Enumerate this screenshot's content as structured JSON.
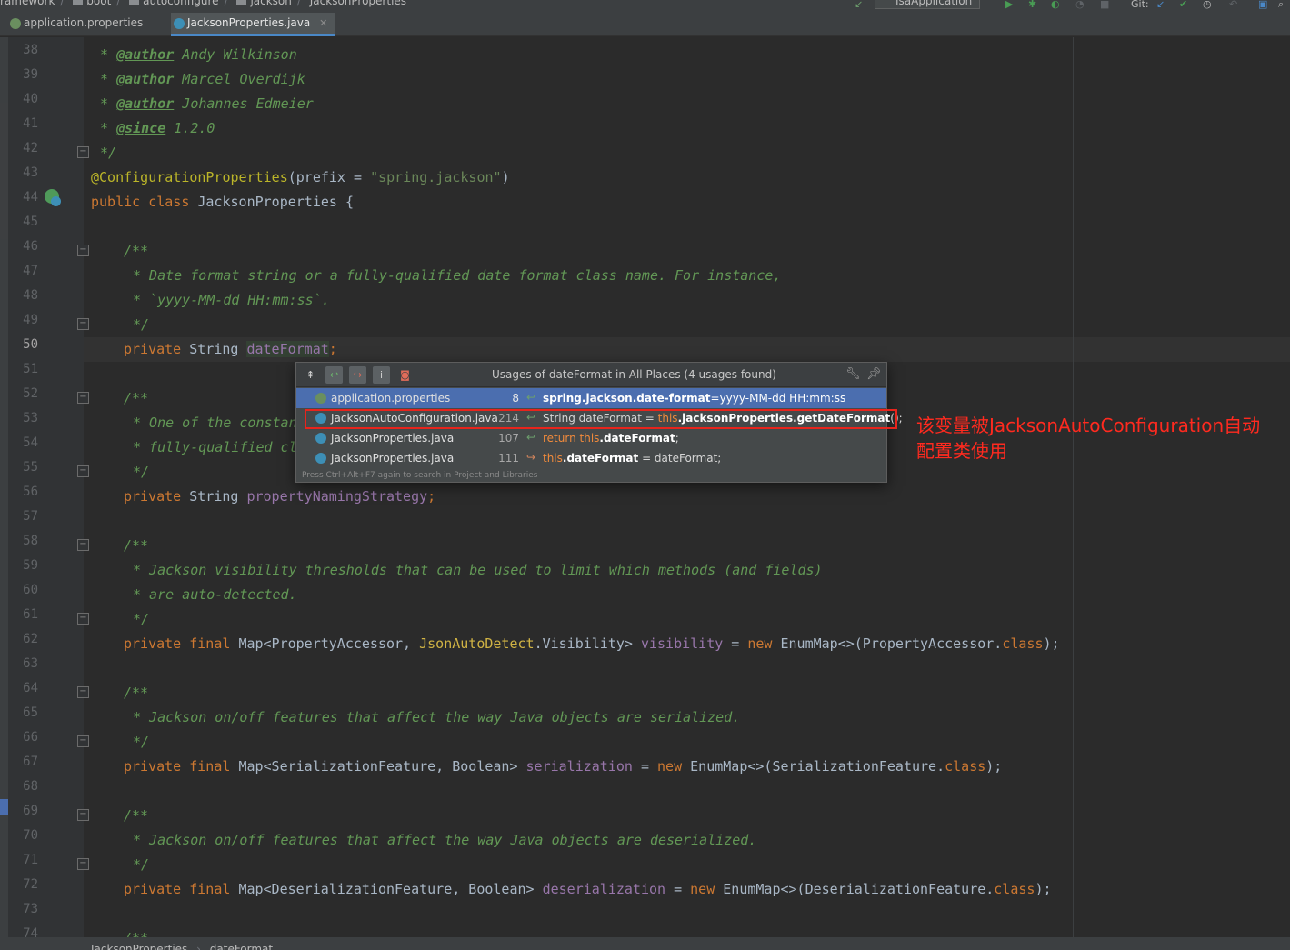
{
  "breadcrumb_top": {
    "items": [
      "ramework",
      "boot",
      "autoconfigure",
      "jackson",
      "JacksonProperties"
    ],
    "run_config": "IsaApplication",
    "git_label": "Git:"
  },
  "tabs": [
    {
      "label": "application.properties",
      "active": false
    },
    {
      "label": "JacksonProperties.java",
      "active": true,
      "close": "✕"
    }
  ],
  "lines": {
    "l38": {
      "num": "38",
      "star": "* ",
      "tag": "@author",
      "text": " Andy Wilkinson"
    },
    "l39": {
      "num": "39",
      "star": "* ",
      "tag": "@author",
      "text": " Marcel Overdijk"
    },
    "l40": {
      "num": "40",
      "star": "* ",
      "tag": "@author",
      "text": " Johannes Edmeier"
    },
    "l41": {
      "num": "41",
      "star": "* ",
      "tag": "@since",
      "text": " 1.2.0"
    },
    "l42": {
      "num": "42",
      "text": "*/"
    },
    "l43": {
      "num": "43",
      "ann": "@ConfigurationProperties",
      "p1": "(prefix = ",
      "str": "\"spring.jackson\"",
      "p2": ")"
    },
    "l44": {
      "num": "44",
      "kw": "public class ",
      "text": "JacksonProperties {"
    },
    "l45": {
      "num": "45"
    },
    "l46": {
      "num": "46",
      "text": "/**"
    },
    "l47": {
      "num": "47",
      "text": "* Date format string or a fully-qualified date format class name. For instance,"
    },
    "l48": {
      "num": "48",
      "text": "* `yyyy-MM-dd HH:mm:ss`."
    },
    "l49": {
      "num": "49",
      "text": "*/"
    },
    "l50": {
      "num": "50",
      "kw": "private ",
      "type": "String ",
      "field": "dateFormat",
      "semi": ";"
    },
    "l51": {
      "num": "51"
    },
    "l52": {
      "num": "52",
      "text": "/**"
    },
    "l53": {
      "num": "53",
      "text": "* One of the constan"
    },
    "l54": {
      "num": "54",
      "text": "* fully-qualified cl"
    },
    "l55": {
      "num": "55",
      "text": "*/"
    },
    "l56": {
      "num": "56",
      "kw": "private ",
      "type": "String ",
      "field": "propertyNamingStrategy",
      "semi": ";"
    },
    "l57": {
      "num": "57"
    },
    "l58": {
      "num": "58",
      "text": "/**"
    },
    "l59": {
      "num": "59",
      "text": "* Jackson visibility thresholds that can be used to limit which methods (and fields)"
    },
    "l60": {
      "num": "60",
      "text": "* are auto-detected."
    },
    "l61": {
      "num": "61",
      "text": "*/"
    },
    "l62": {
      "num": "62",
      "kw": "private final ",
      "t1": "Map<PropertyAccessor, ",
      "t2": "JsonAutoDetect",
      "t3": ".Visibility> ",
      "field": "visibility",
      "eq": " = ",
      "new": "new ",
      "t4": "EnumMap<>(PropertyAccessor.",
      "cls": "class",
      "end": ");"
    },
    "l63": {
      "num": "63"
    },
    "l64": {
      "num": "64",
      "text": "/**"
    },
    "l65": {
      "num": "65",
      "text": "* Jackson on/off features that affect the way Java objects are serialized."
    },
    "l66": {
      "num": "66",
      "text": "*/"
    },
    "l67": {
      "num": "67",
      "kw": "private final ",
      "t1": "Map<SerializationFeature, Boolean> ",
      "field": "serialization",
      "eq": " = ",
      "new": "new ",
      "t4": "EnumMap<>(SerializationFeature.",
      "cls": "class",
      "end": ");"
    },
    "l68": {
      "num": "68"
    },
    "l69": {
      "num": "69",
      "text": "/**"
    },
    "l70": {
      "num": "70",
      "text": "* Jackson on/off features that affect the way Java objects are deserialized."
    },
    "l71": {
      "num": "71",
      "text": "*/"
    },
    "l72": {
      "num": "72",
      "kw": "private final ",
      "t1": "Map<DeserializationFeature, Boolean> ",
      "field": "deserialization",
      "eq": " = ",
      "new": "new ",
      "t4": "EnumMap<>(DeserializationFeature.",
      "cls": "class",
      "end": ");"
    },
    "l73": {
      "num": "73"
    },
    "l74": {
      "num": "74",
      "text": "/**"
    }
  },
  "popup": {
    "title": "Usages of dateFormat in All Places (4 usages found)",
    "toolbar": [
      "⇞",
      "↩",
      "↪",
      "i",
      "◙"
    ],
    "rows": [
      {
        "file": "application.properties",
        "line": "8",
        "pre": "",
        "key": "",
        "bold": "spring.jackson.date-format",
        "post": "=yyyy-MM-dd HH:mm:ss",
        "selected": true
      },
      {
        "file": "JacksonAutoConfiguration.java",
        "line": "214",
        "pre": "String dateFormat = ",
        "key": "this",
        "bold": ".jacksonProperties.getDateFormat",
        "post": "();",
        "selected": false
      },
      {
        "file": "JacksonProperties.java",
        "line": "107",
        "pre": "",
        "key": "return this",
        "bold": ".dateFormat",
        "post": ";",
        "selected": false
      },
      {
        "file": "JacksonProperties.java",
        "line": "111",
        "pre": "",
        "key": "this",
        "bold": ".dateFormat",
        "post": " = dateFormat;",
        "selected": false
      }
    ],
    "footer": "Press Ctrl+Alt+F7 again to search in Project and Libraries"
  },
  "annotation": {
    "note": "该变量被JacksonAutoConfiguration自动配置类使用",
    "color": "#ff2a1f"
  },
  "status": {
    "breadcrumb": [
      "JacksonProperties",
      "dateFormat"
    ]
  }
}
